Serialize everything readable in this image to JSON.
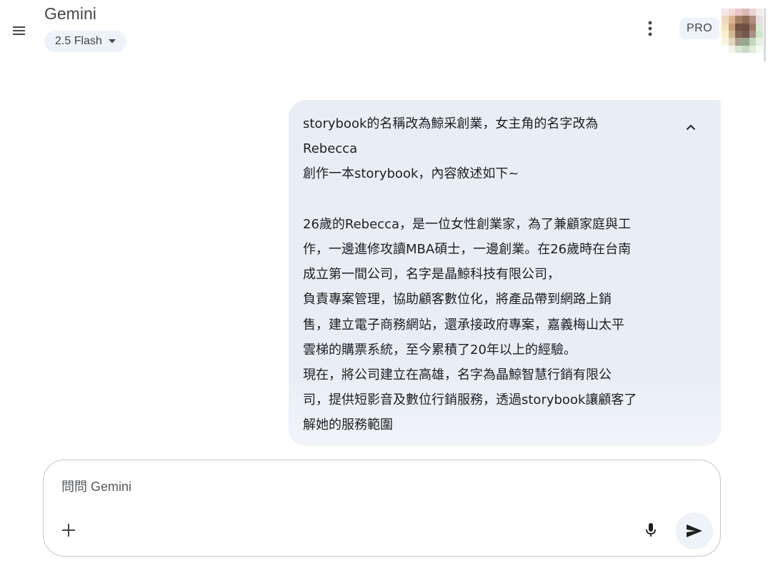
{
  "header": {
    "title": "Gemini",
    "model_label": "2.5 Flash",
    "pro_badge": "PRO",
    "icons": {
      "menu": "menu-icon",
      "model_dropdown": "caret-down-icon",
      "more": "more-vert-icon"
    }
  },
  "conversation": {
    "user_message": "storybook的名稱改為鯨采創業，女主角的名字改為\nRebecca\n創作一本storybook，內容敘述如下~\n\n26歲的Rebecca，是一位女性創業家，為了兼顧家庭與工\n作，一邊進修攻讀MBA碩士，一邊創業。在26歲時在台南\n成立第一間公司，名字是晶鯨科技有限公司，\n負責專案管理，協助顧客數位化，將產品帶到網路上銷\n售，建立電子商務網站，還承接政府專案，嘉義梅山太平\n雲梯的購票系統，至今累積了20年以上的經驗。\n現在，將公司建立在高雄，名字為晶鯨智慧行銷有限公\n司，提供短影音及數位行銷服務，透過storybook讓顧客了\n解她的服務範圍",
    "collapse_icon": "chevron-up-icon"
  },
  "composer": {
    "placeholder": "問問 Gemini",
    "value": "",
    "icons": {
      "add": "plus-icon",
      "mic": "mic-icon",
      "send": "send-icon"
    }
  },
  "colors": {
    "bubble_bg": "#e9eef6",
    "chip_bg": "#eef2f9",
    "text_primary": "#1f1f1f",
    "text_secondary": "#444746",
    "border": "#c4c7c5"
  }
}
